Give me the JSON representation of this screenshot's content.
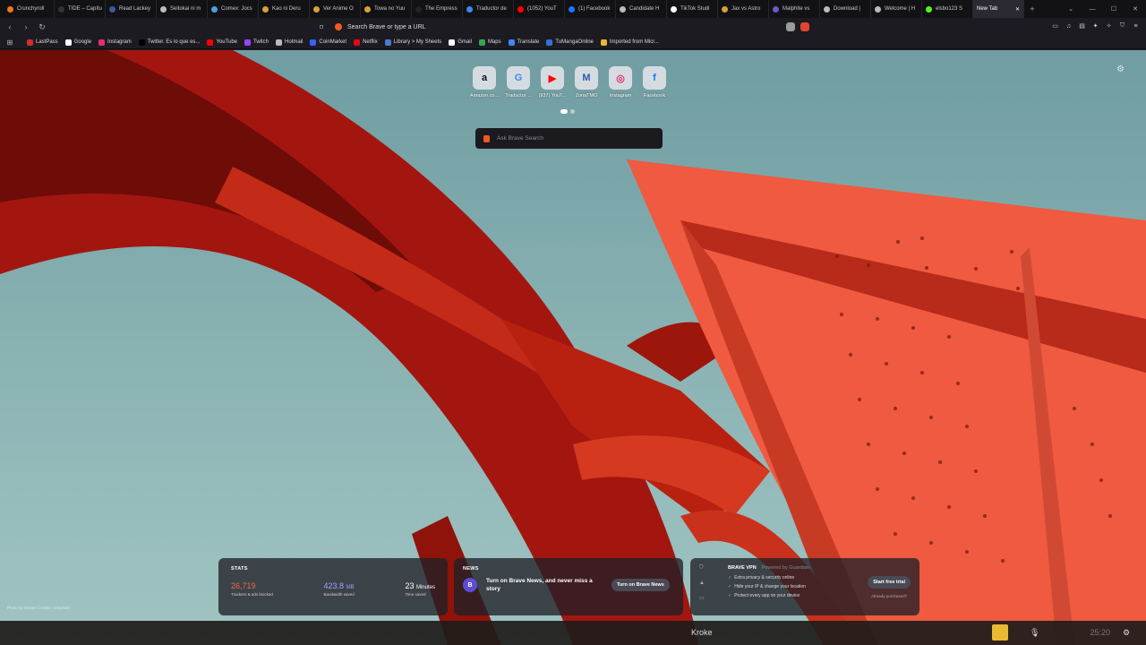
{
  "tabs": [
    {
      "label": "Crunchyroll",
      "color": "#f47521"
    },
    {
      "label": "TIDE – Capítu",
      "color": "#333"
    },
    {
      "label": "Read Lackey",
      "color": "#3a5ba0"
    },
    {
      "label": "Seitokai ni m",
      "color": "#bbb"
    },
    {
      "label": "Comex: Jocs",
      "color": "#4aa3df"
    },
    {
      "label": "Kao ni Deru",
      "color": "#d9a035"
    },
    {
      "label": "Ver Anime O",
      "color": "#d9a035"
    },
    {
      "label": "Towa no Yuu",
      "color": "#d9a035"
    },
    {
      "label": "The Empress",
      "color": "#222"
    },
    {
      "label": "Traductor de",
      "color": "#4285f4"
    },
    {
      "label": "(1052) YouT",
      "color": "#ff0000"
    },
    {
      "label": "(1) Facebook",
      "color": "#1877f2"
    },
    {
      "label": "Candidate H",
      "color": "#bbb"
    },
    {
      "label": "TikTok Studi",
      "color": "#fff"
    },
    {
      "label": "Jax vs Astro",
      "color": "#d9a035"
    },
    {
      "label": "Malphite vs",
      "color": "#6a5acd"
    },
    {
      "label": "Download |",
      "color": "#bbb"
    },
    {
      "label": "Welcome | H",
      "color": "#bbb"
    },
    {
      "label": "elsbo123 S",
      "color": "#53fc18"
    }
  ],
  "active_tab": {
    "label": "New Tab",
    "close": "✕"
  },
  "new_tab_symbol": "+",
  "address": {
    "placeholder": "Search Brave or type a URL"
  },
  "bookmarks": [
    {
      "label": "LastPass",
      "color": "#d32d27"
    },
    {
      "label": "Google",
      "color": "#ffffff"
    },
    {
      "label": "Instagram",
      "color": "#e1306c"
    },
    {
      "label": "Twitter. Es lo que es...",
      "color": "#000000"
    },
    {
      "label": "YouTube",
      "color": "#ff0000"
    },
    {
      "label": "Twitch",
      "color": "#9146ff"
    },
    {
      "label": "Hotmail",
      "color": "#bbbbbb"
    },
    {
      "label": "CoinMarket",
      "color": "#3861fb"
    },
    {
      "label": "Netflix",
      "color": "#e50914"
    },
    {
      "label": "Library > My Sheets",
      "color": "#4a7bd0"
    },
    {
      "label": "Gmail",
      "color": "#ffffff"
    },
    {
      "label": "Maps",
      "color": "#34a853"
    },
    {
      "label": "Translate",
      "color": "#4285f4"
    },
    {
      "label": "TuMangaOnline",
      "color": "#2f73d6"
    },
    {
      "label": "Imported from Micr...",
      "color": "#e8b931"
    }
  ],
  "top_sites": [
    {
      "label": "Amazon.co...",
      "glyph": "a",
      "color": "#111111"
    },
    {
      "label": "Traductor ...",
      "glyph": "G",
      "color": "#4285f4"
    },
    {
      "label": "(937) YouT...",
      "glyph": "▶",
      "color": "#ff0000"
    },
    {
      "label": "ZonaTMO",
      "glyph": "M",
      "color": "#2f5aa8"
    },
    {
      "label": "Instagram",
      "glyph": "◎",
      "color": "#e1306c"
    },
    {
      "label": "Facebook",
      "glyph": "f",
      "color": "#1877f2"
    }
  ],
  "search": {
    "placeholder": "Ask Brave Search"
  },
  "stats": {
    "title": "STATS",
    "trackers_value": "26,719",
    "trackers_label": "Trackers & ads blocked",
    "bandwidth_value": "423.8",
    "bandwidth_unit": "MB",
    "bandwidth_label": "Bandwidth saved",
    "time_value": "23",
    "time_unit": "Minutes",
    "time_label": "Time saved"
  },
  "news": {
    "title": "NEWS",
    "logo": "B",
    "message": "Turn on Brave News, and never miss a story",
    "button": "Turn on Brave News"
  },
  "vpn": {
    "title": "BRAVE VPN",
    "powered": "Powered by Guardian",
    "features": [
      "Extra privacy & security online",
      "Hide your IP & change your location",
      "Protect every app on your device"
    ],
    "button": "Start free trial",
    "purchased": "Already purchased?"
  },
  "photo_credit": "Photo by Steven Cordes, Unsplash",
  "taskbar": {
    "app_label": "Kroke",
    "clock": "25:20"
  },
  "colors": {
    "accent_red": "#e2452f",
    "brave_orange": "#f15a22",
    "stats_orange": "#f66b4f",
    "stats_purple": "#a99bff"
  }
}
